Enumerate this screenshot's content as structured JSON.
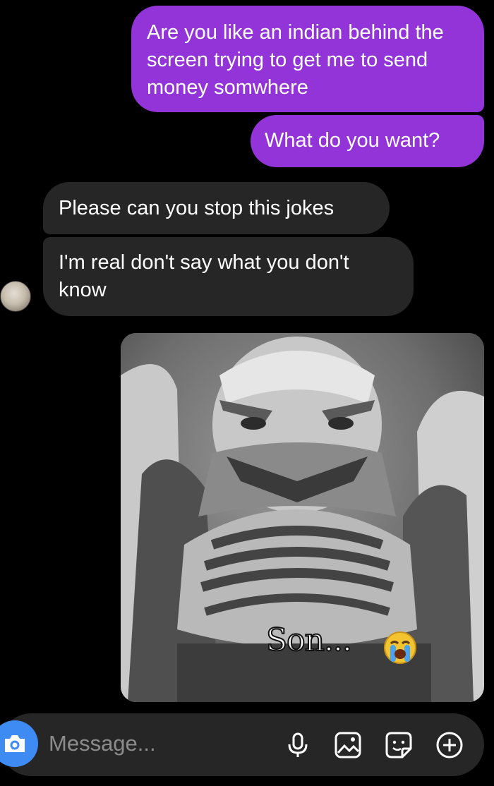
{
  "messages": [
    {
      "side": "outgoing",
      "text": "Are you like an indian behind the screen trying to get me to send money somwhere"
    },
    {
      "side": "outgoing",
      "text": "What do you want?"
    },
    {
      "side": "incoming",
      "text": "Please can you stop this jokes"
    },
    {
      "side": "incoming",
      "text": "I'm real don't say what you don't know"
    }
  ],
  "media": {
    "caption": "Son...",
    "emoji": "loudly-crying-face"
  },
  "composer": {
    "placeholder": "Message...",
    "icons": [
      "camera-icon",
      "microphone-icon",
      "gallery-icon",
      "sticker-icon",
      "plus-icon"
    ]
  },
  "colors": {
    "outgoing_bubble": "#9334d8",
    "incoming_bubble": "#262626",
    "camera_button": "#3f8bf4",
    "background": "#000000"
  }
}
